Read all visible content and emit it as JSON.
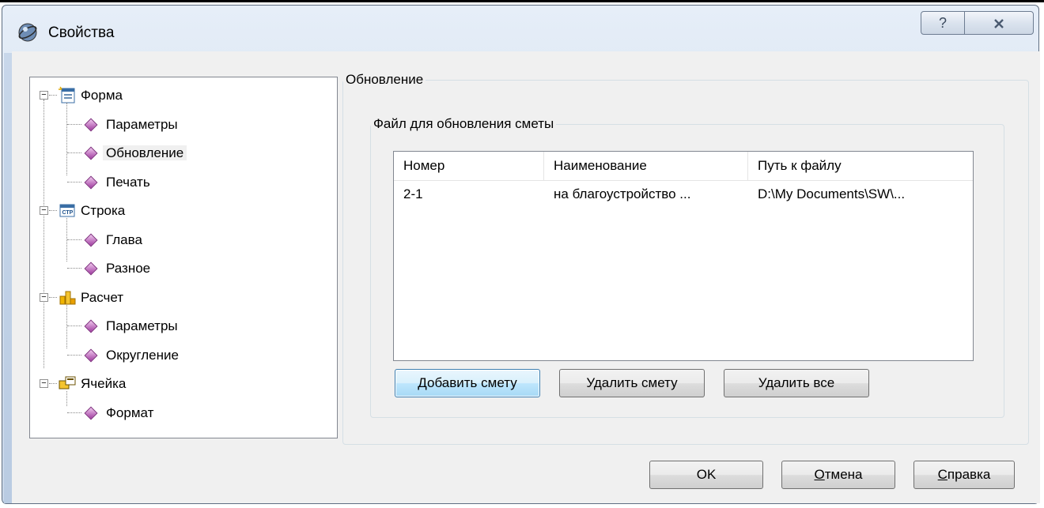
{
  "window": {
    "title": "Свойства",
    "help_glyph": "?",
    "close_glyph": "X"
  },
  "tree": {
    "groups": [
      {
        "label": "Форма",
        "icon": "form-icon",
        "children": [
          "Параметры",
          "Обновление",
          "Печать"
        ]
      },
      {
        "label": "Строка",
        "icon": "row-icon",
        "children": [
          "Глава",
          "Разное"
        ]
      },
      {
        "label": "Расчет",
        "icon": "calculation-icon",
        "children": [
          "Параметры",
          "Округление"
        ]
      },
      {
        "label": "Ячейка",
        "icon": "cell-icon",
        "children": [
          "Формат"
        ]
      }
    ],
    "selected": "Обновление",
    "expander_glyph": "−"
  },
  "panel": {
    "group_title": "Обновление",
    "file_group_title": "Файл для обновления сметы",
    "columns": [
      "Номер",
      "Наименование",
      "Путь к файлу"
    ],
    "rows": [
      [
        "2-1",
        "на благоустройство ...",
        "D:\\My Documents\\SW\\..."
      ]
    ],
    "buttons": {
      "add": "Добавить смету",
      "delete": "Удалить смету",
      "delete_all": "Удалить все"
    }
  },
  "footer": {
    "ok": "OK",
    "cancel_first": "О",
    "cancel_rest": "тмена",
    "help_first": "С",
    "help_rest": "правка"
  },
  "colors": {
    "selection": "#f0f0f0",
    "default_button": "#3c7fb1",
    "frame": "#cfdcec"
  }
}
